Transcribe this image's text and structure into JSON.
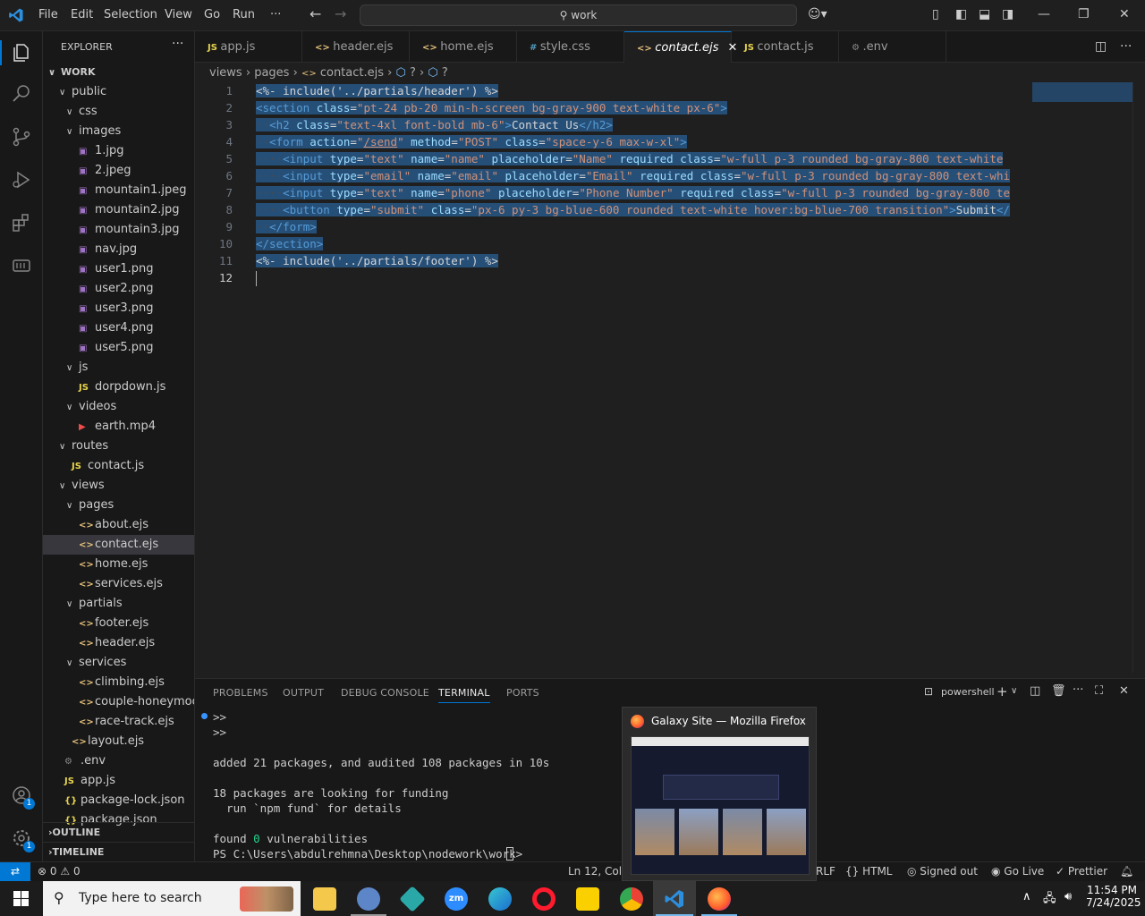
{
  "titlebar": {
    "menu": [
      "File",
      "Edit",
      "Selection",
      "View",
      "Go",
      "Run",
      "···"
    ],
    "search": "work"
  },
  "sidebar": {
    "title": "EXPLORER",
    "root": "WORK",
    "items": [
      {
        "label": "public",
        "icon": "folder-open",
        "depth": 1
      },
      {
        "label": "css",
        "icon": "folder-open",
        "depth": 2
      },
      {
        "label": "images",
        "icon": "folder-open",
        "depth": 2
      },
      {
        "label": "1.jpg",
        "icon": "image",
        "depth": 3
      },
      {
        "label": "2.jpeg",
        "icon": "image",
        "depth": 3
      },
      {
        "label": "mountain1.jpeg",
        "icon": "image",
        "depth": 3
      },
      {
        "label": "mountain2.jpg",
        "icon": "image",
        "depth": 3
      },
      {
        "label": "mountain3.jpg",
        "icon": "image",
        "depth": 3
      },
      {
        "label": "nav.jpg",
        "icon": "image",
        "depth": 3
      },
      {
        "label": "user1.png",
        "icon": "image",
        "depth": 3
      },
      {
        "label": "user2.png",
        "icon": "image",
        "depth": 3
      },
      {
        "label": "user3.png",
        "icon": "image",
        "depth": 3
      },
      {
        "label": "user4.png",
        "icon": "image",
        "depth": 3
      },
      {
        "label": "user5.png",
        "icon": "image",
        "depth": 3
      },
      {
        "label": "js",
        "icon": "folder-open",
        "depth": 2
      },
      {
        "label": "dorpdown.js",
        "icon": "js",
        "depth": 3
      },
      {
        "label": "videos",
        "icon": "folder-open",
        "depth": 2
      },
      {
        "label": "earth.mp4",
        "icon": "video",
        "depth": 3
      },
      {
        "label": "routes",
        "icon": "folder-open",
        "depth": 1
      },
      {
        "label": "contact.js",
        "icon": "js",
        "depth": 2
      },
      {
        "label": "views",
        "icon": "folder-open",
        "depth": 1
      },
      {
        "label": "pages",
        "icon": "folder-open",
        "depth": 2
      },
      {
        "label": "about.ejs",
        "icon": "ejs",
        "depth": 3
      },
      {
        "label": "contact.ejs",
        "icon": "ejs",
        "depth": 3,
        "selected": true
      },
      {
        "label": "home.ejs",
        "icon": "ejs",
        "depth": 3
      },
      {
        "label": "services.ejs",
        "icon": "ejs",
        "depth": 3
      },
      {
        "label": "partials",
        "icon": "folder-open",
        "depth": 2
      },
      {
        "label": "footer.ejs",
        "icon": "ejs",
        "depth": 3
      },
      {
        "label": "header.ejs",
        "icon": "ejs",
        "depth": 3
      },
      {
        "label": "services",
        "icon": "folder-open",
        "depth": 2
      },
      {
        "label": "climbing.ejs",
        "icon": "ejs",
        "depth": 3
      },
      {
        "label": "couple-honeymoo...",
        "icon": "ejs",
        "depth": 3
      },
      {
        "label": "race-track.ejs",
        "icon": "ejs",
        "depth": 3
      },
      {
        "label": "layout.ejs",
        "icon": "ejs",
        "depth": 2
      },
      {
        "label": ".env",
        "icon": "env",
        "depth": 1
      },
      {
        "label": "app.js",
        "icon": "js",
        "depth": 1
      },
      {
        "label": "package-lock.json",
        "icon": "json",
        "depth": 1
      },
      {
        "label": "package.json",
        "icon": "json",
        "depth": 1
      }
    ],
    "outline": "OUTLINE",
    "timeline": "TIMELINE"
  },
  "tabs": [
    {
      "label": "app.js",
      "icon": "js"
    },
    {
      "label": "header.ejs",
      "icon": "ejs"
    },
    {
      "label": "home.ejs",
      "icon": "ejs"
    },
    {
      "label": "style.css",
      "icon": "css"
    },
    {
      "label": "contact.ejs",
      "icon": "ejs",
      "active": true
    },
    {
      "label": "contact.js",
      "icon": "js"
    },
    {
      "label": ".env",
      "icon": "env"
    }
  ],
  "breadcrumb": [
    "views",
    "pages",
    "contact.ejs",
    "?",
    "?"
  ],
  "editor": {
    "lines": [
      "1",
      "2",
      "3",
      "4",
      "5",
      "6",
      "7",
      "8",
      "9",
      "10",
      "11",
      "12"
    ]
  },
  "panel": {
    "tabs": [
      "PROBLEMS",
      "OUTPUT",
      "DEBUG CONSOLE",
      "TERMINAL",
      "PORTS"
    ],
    "shell": "powershell",
    "terminal": [
      ">>",
      ">>",
      "",
      "added 21 packages, and audited 108 packages in 10s",
      "",
      "18 packages are looking for funding",
      "  run `npm fund` for details",
      "",
      "found 0 vulnerabilities",
      "PS C:\\Users\\abdulrehmna\\Desktop\\nodework\\work> "
    ]
  },
  "statusbar": {
    "errors": "0",
    "warnings": "0",
    "position": "Ln 12, Col 1",
    "eol": "RLF",
    "language": "HTML",
    "account": "Signed out",
    "golive": "Go Live",
    "prettier": "Prettier"
  },
  "preview": {
    "title": "Galaxy Site — Mozilla Firefox"
  },
  "taskbar": {
    "search_placeholder": "Type here to search",
    "time": "11:54 PM",
    "date": "7/24/2025"
  },
  "colors": {
    "accent": "#0078d4",
    "selection": "#264f78",
    "remote": "#0078d4"
  }
}
